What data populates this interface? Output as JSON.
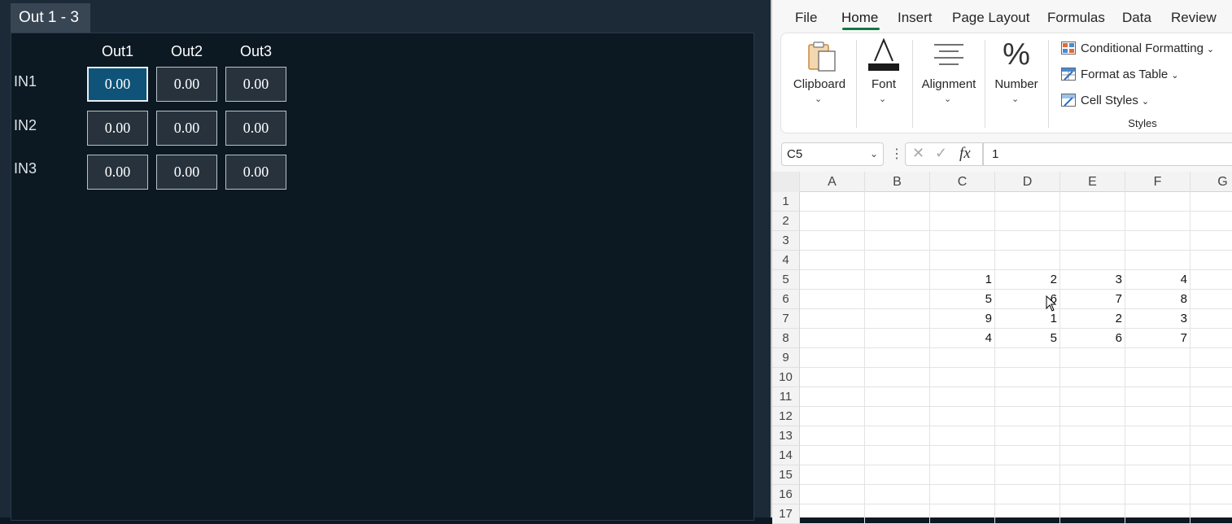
{
  "left_app": {
    "tab_label": "Out 1 - 3",
    "columns": [
      "Out1",
      "Out2",
      "Out3"
    ],
    "rows": [
      {
        "label": "IN1",
        "values": [
          "0.00",
          "0.00",
          "0.00"
        ]
      },
      {
        "label": "IN2",
        "values": [
          "0.00",
          "0.00",
          "0.00"
        ]
      },
      {
        "label": "IN3",
        "values": [
          "0.00",
          "0.00",
          "0.00"
        ]
      }
    ]
  },
  "excel": {
    "menu": [
      "File",
      "Home",
      "Insert",
      "Page Layout",
      "Formulas",
      "Data",
      "Review"
    ],
    "ribbon": {
      "clipboard": "Clipboard",
      "font": "Font",
      "alignment": "Alignment",
      "number": "Number",
      "conditional_formatting": "Conditional Formatting",
      "format_as_table": "Format as Table",
      "cell_styles": "Cell Styles",
      "styles_group": "Styles"
    },
    "name_box": "C5",
    "fx_label": "fx",
    "formula": "1",
    "col_headers": [
      "A",
      "B",
      "C",
      "D",
      "E",
      "F",
      "G"
    ],
    "row_headers": [
      "1",
      "2",
      "3",
      "4",
      "5",
      "6",
      "7",
      "8",
      "9",
      "10",
      "11",
      "12",
      "13",
      "14",
      "15",
      "16",
      "17"
    ],
    "cells": {
      "r5": [
        "1",
        "2",
        "3",
        "4"
      ],
      "r6": [
        "5",
        "6",
        "7",
        "8"
      ],
      "r7": [
        "9",
        "1",
        "2",
        "3"
      ],
      "r8": [
        "4",
        "5",
        "6",
        "7"
      ]
    },
    "accent": "#117744"
  }
}
